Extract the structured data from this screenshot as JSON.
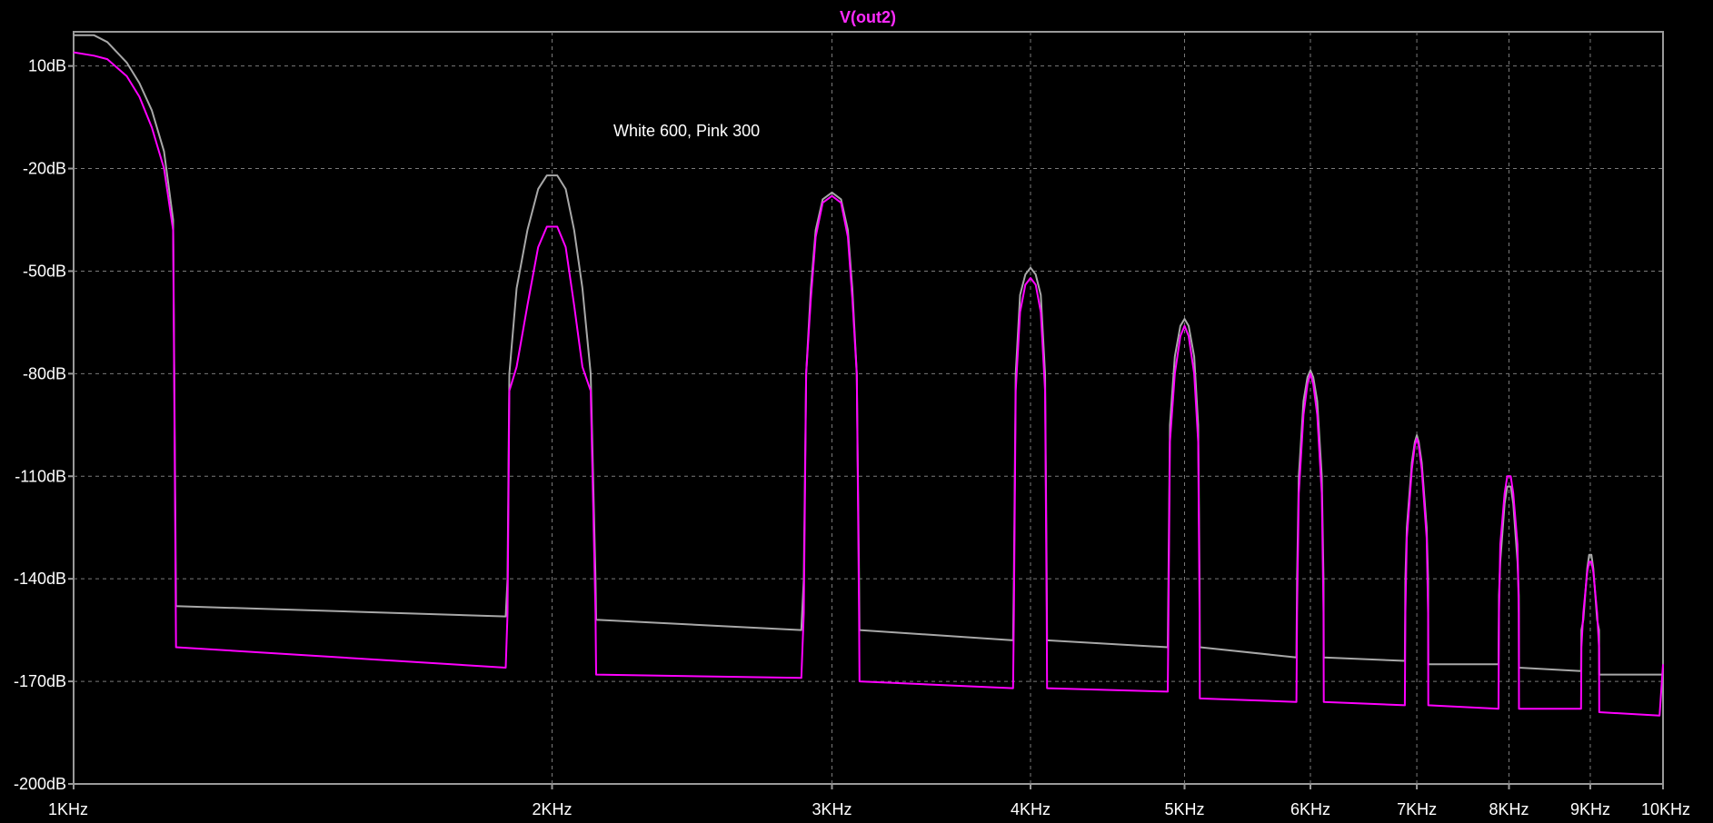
{
  "chart_data": {
    "type": "line",
    "title": "V(out2)",
    "annotation": "White 600, Pink 300",
    "xscale": "log",
    "xlim": [
      1000,
      10000
    ],
    "ylim": [
      -200,
      20
    ],
    "x_ticks": [
      {
        "value": 1000,
        "label": "1KHz"
      },
      {
        "value": 2000,
        "label": "2KHz"
      },
      {
        "value": 3000,
        "label": "3KHz"
      },
      {
        "value": 4000,
        "label": "4KHz"
      },
      {
        "value": 5000,
        "label": "5KHz"
      },
      {
        "value": 6000,
        "label": "6KHz"
      },
      {
        "value": 7000,
        "label": "7KHz"
      },
      {
        "value": 8000,
        "label": "8KHz"
      },
      {
        "value": 9000,
        "label": "9KHz"
      },
      {
        "value": 10000,
        "label": "10KHz"
      }
    ],
    "y_ticks": [
      {
        "value": 10,
        "label": "10dB"
      },
      {
        "value": -20,
        "label": "-20dB"
      },
      {
        "value": -50,
        "label": "-50dB"
      },
      {
        "value": -80,
        "label": "-80dB"
      },
      {
        "value": -110,
        "label": "-110dB"
      },
      {
        "value": -140,
        "label": "-140dB"
      },
      {
        "value": -170,
        "label": "-170dB"
      },
      {
        "value": -200,
        "label": "-200dB"
      }
    ],
    "grid": true,
    "colors": {
      "background": "#000000",
      "grid": "#7a7a7a",
      "axis": "#9a9a9a",
      "title": "#ff2bff"
    },
    "series": [
      {
        "color": "#a8a8a8",
        "points": [
          [
            1000,
            19
          ],
          [
            1030,
            19
          ],
          [
            1050,
            17
          ],
          [
            1080,
            11
          ],
          [
            1100,
            5
          ],
          [
            1120,
            -3
          ],
          [
            1140,
            -15
          ],
          [
            1155,
            -35
          ],
          [
            1160,
            -148
          ],
          [
            1870,
            -151
          ],
          [
            1875,
            -140
          ],
          [
            1880,
            -80
          ],
          [
            1900,
            -55
          ],
          [
            1930,
            -38
          ],
          [
            1960,
            -26
          ],
          [
            1985,
            -22
          ],
          [
            2015,
            -22
          ],
          [
            2040,
            -26
          ],
          [
            2065,
            -38
          ],
          [
            2090,
            -55
          ],
          [
            2115,
            -80
          ],
          [
            2130,
            -140
          ],
          [
            2132,
            -152
          ],
          [
            2870,
            -155
          ],
          [
            2880,
            -140
          ],
          [
            2890,
            -80
          ],
          [
            2910,
            -55
          ],
          [
            2930,
            -38
          ],
          [
            2960,
            -29
          ],
          [
            3000,
            -27
          ],
          [
            3040,
            -29
          ],
          [
            3070,
            -38
          ],
          [
            3090,
            -55
          ],
          [
            3110,
            -80
          ],
          [
            3120,
            -140
          ],
          [
            3122,
            -155
          ],
          [
            3900,
            -158
          ],
          [
            3905,
            -140
          ],
          [
            3915,
            -80
          ],
          [
            3940,
            -57
          ],
          [
            3970,
            -51
          ],
          [
            4000,
            -49
          ],
          [
            4030,
            -51
          ],
          [
            4060,
            -57
          ],
          [
            4085,
            -80
          ],
          [
            4095,
            -140
          ],
          [
            4097,
            -158
          ],
          [
            4880,
            -160
          ],
          [
            4885,
            -140
          ],
          [
            4895,
            -95
          ],
          [
            4930,
            -75
          ],
          [
            4970,
            -66
          ],
          [
            5000,
            -64
          ],
          [
            5030,
            -66
          ],
          [
            5070,
            -75
          ],
          [
            5100,
            -95
          ],
          [
            5110,
            -140
          ],
          [
            5112,
            -160
          ],
          [
            5880,
            -163
          ],
          [
            5885,
            -140
          ],
          [
            5900,
            -110
          ],
          [
            5940,
            -88
          ],
          [
            5975,
            -81
          ],
          [
            6000,
            -79
          ],
          [
            6025,
            -81
          ],
          [
            6060,
            -88
          ],
          [
            6100,
            -110
          ],
          [
            6115,
            -140
          ],
          [
            6117,
            -163
          ],
          [
            6880,
            -164
          ],
          [
            6885,
            -140
          ],
          [
            6900,
            -125
          ],
          [
            6950,
            -106
          ],
          [
            6980,
            -100
          ],
          [
            7000,
            -98
          ],
          [
            7020,
            -100
          ],
          [
            7050,
            -106
          ],
          [
            7100,
            -125
          ],
          [
            7115,
            -140
          ],
          [
            7117,
            -165
          ],
          [
            7880,
            -165
          ],
          [
            7885,
            -145
          ],
          [
            7900,
            -135
          ],
          [
            7950,
            -118
          ],
          [
            7980,
            -113
          ],
          [
            8000,
            -113
          ],
          [
            8020,
            -113
          ],
          [
            8050,
            -118
          ],
          [
            8100,
            -135
          ],
          [
            8115,
            -145
          ],
          [
            8117,
            -166
          ],
          [
            8880,
            -167
          ],
          [
            8885,
            -155
          ],
          [
            8910,
            -152
          ],
          [
            8960,
            -137
          ],
          [
            8985,
            -133
          ],
          [
            9000,
            -133
          ],
          [
            9015,
            -133
          ],
          [
            9040,
            -137
          ],
          [
            9090,
            -152
          ],
          [
            9115,
            -155
          ],
          [
            9117,
            -168
          ],
          [
            10000,
            -168
          ]
        ]
      },
      {
        "color": "#ff00ff",
        "points": [
          [
            1000,
            14
          ],
          [
            1030,
            13
          ],
          [
            1050,
            12
          ],
          [
            1080,
            7
          ],
          [
            1100,
            1
          ],
          [
            1120,
            -8
          ],
          [
            1140,
            -20
          ],
          [
            1155,
            -38
          ],
          [
            1160,
            -160
          ],
          [
            1870,
            -166
          ],
          [
            1875,
            -150
          ],
          [
            1880,
            -85
          ],
          [
            1900,
            -78
          ],
          [
            1930,
            -60
          ],
          [
            1960,
            -43
          ],
          [
            1985,
            -37
          ],
          [
            2015,
            -37
          ],
          [
            2040,
            -43
          ],
          [
            2065,
            -60
          ],
          [
            2090,
            -78
          ],
          [
            2115,
            -85
          ],
          [
            2130,
            -150
          ],
          [
            2132,
            -168
          ],
          [
            2870,
            -169
          ],
          [
            2880,
            -150
          ],
          [
            2890,
            -80
          ],
          [
            2910,
            -58
          ],
          [
            2930,
            -40
          ],
          [
            2960,
            -30
          ],
          [
            3000,
            -28
          ],
          [
            3040,
            -30
          ],
          [
            3070,
            -40
          ],
          [
            3090,
            -58
          ],
          [
            3110,
            -80
          ],
          [
            3120,
            -150
          ],
          [
            3122,
            -170
          ],
          [
            3900,
            -172
          ],
          [
            3905,
            -150
          ],
          [
            3915,
            -85
          ],
          [
            3940,
            -62
          ],
          [
            3970,
            -54
          ],
          [
            4000,
            -52
          ],
          [
            4030,
            -54
          ],
          [
            4060,
            -62
          ],
          [
            4085,
            -85
          ],
          [
            4095,
            -150
          ],
          [
            4097,
            -172
          ],
          [
            4880,
            -173
          ],
          [
            4885,
            -150
          ],
          [
            4895,
            -100
          ],
          [
            4930,
            -80
          ],
          [
            4970,
            -69
          ],
          [
            5000,
            -66
          ],
          [
            5030,
            -69
          ],
          [
            5070,
            -80
          ],
          [
            5100,
            -100
          ],
          [
            5110,
            -150
          ],
          [
            5112,
            -175
          ],
          [
            5880,
            -176
          ],
          [
            5885,
            -150
          ],
          [
            5900,
            -115
          ],
          [
            5940,
            -92
          ],
          [
            5975,
            -83
          ],
          [
            6000,
            -80
          ],
          [
            6025,
            -83
          ],
          [
            6060,
            -92
          ],
          [
            6100,
            -115
          ],
          [
            6115,
            -150
          ],
          [
            6117,
            -176
          ],
          [
            6880,
            -177
          ],
          [
            6885,
            -150
          ],
          [
            6900,
            -128
          ],
          [
            6950,
            -108
          ],
          [
            6980,
            -101
          ],
          [
            7000,
            -99
          ],
          [
            7020,
            -101
          ],
          [
            7050,
            -108
          ],
          [
            7100,
            -128
          ],
          [
            7115,
            -150
          ],
          [
            7117,
            -177
          ],
          [
            7880,
            -178
          ],
          [
            7885,
            -150
          ],
          [
            7900,
            -130
          ],
          [
            7950,
            -115
          ],
          [
            7980,
            -110
          ],
          [
            8000,
            -110
          ],
          [
            8020,
            -110
          ],
          [
            8050,
            -115
          ],
          [
            8100,
            -130
          ],
          [
            8115,
            -150
          ],
          [
            8117,
            -178
          ],
          [
            8880,
            -178
          ],
          [
            8885,
            -160
          ],
          [
            8910,
            -150
          ],
          [
            8960,
            -138
          ],
          [
            8985,
            -135
          ],
          [
            9000,
            -135
          ],
          [
            9015,
            -135
          ],
          [
            9040,
            -138
          ],
          [
            9090,
            -150
          ],
          [
            9115,
            -160
          ],
          [
            9117,
            -179
          ],
          [
            9950,
            -180
          ],
          [
            10000,
            -165
          ]
        ]
      }
    ]
  }
}
